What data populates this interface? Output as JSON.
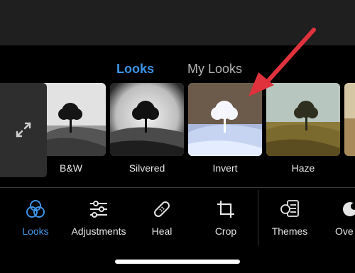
{
  "tabs": {
    "looks": "Looks",
    "my_looks": "My Looks"
  },
  "thumbnails": [
    {
      "label": ""
    },
    {
      "label": "B&W"
    },
    {
      "label": "Silvered"
    },
    {
      "label": "Invert"
    },
    {
      "label": "Haze"
    },
    {
      "label": ""
    }
  ],
  "nav": {
    "looks": "Looks",
    "adjustments": "Adjustments",
    "heal": "Heal",
    "crop": "Crop",
    "themes": "Themes",
    "overlays": "Ove"
  },
  "colors": {
    "accent": "#3d94e6",
    "annotation_arrow": "#e0323c"
  },
  "icons": {
    "expand": "expand-arrows-icon",
    "looks": "three-circles-icon",
    "adjustments": "sliders-icon",
    "heal": "bandage-icon",
    "crop": "crop-icon",
    "themes": "themes-icon"
  }
}
